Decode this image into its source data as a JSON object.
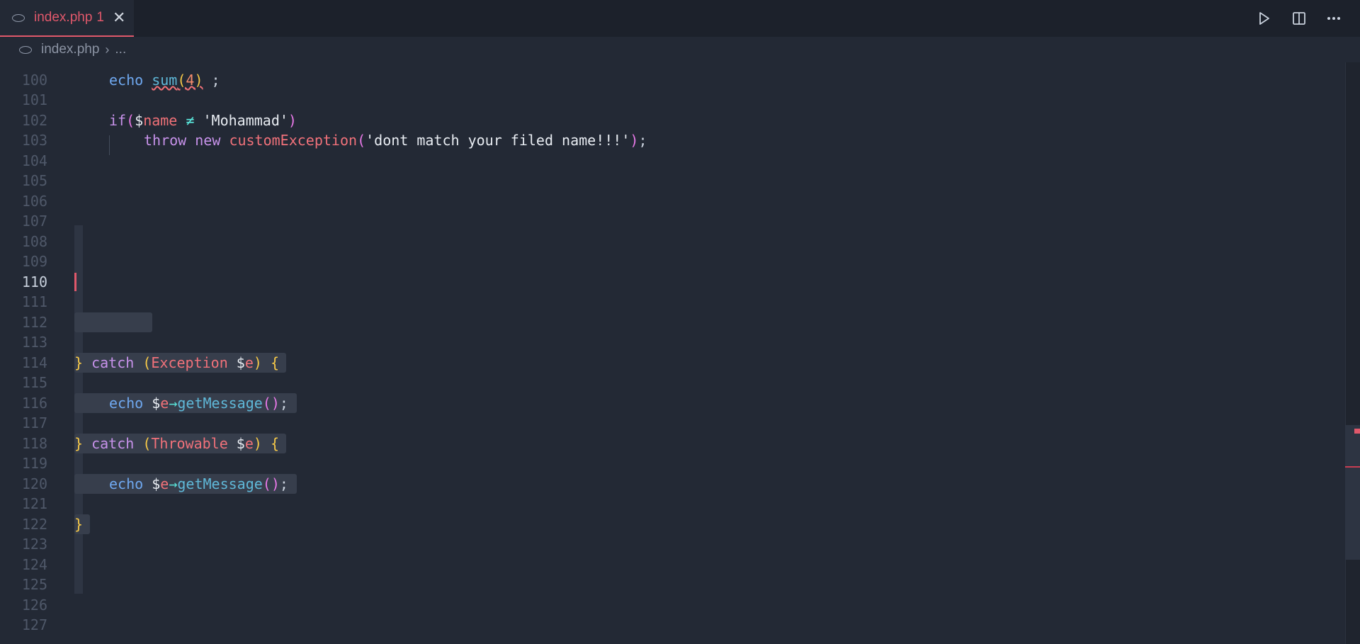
{
  "tab": {
    "file_icon": "php-icon",
    "label": "index.php",
    "problem_count": "1",
    "close_icon": "close-icon"
  },
  "toolbar": {
    "run_icon": "play-icon",
    "split_icon": "split-editor-icon",
    "more_icon": "more-actions-icon"
  },
  "breadcrumb": {
    "file": "index.php",
    "more": "..."
  },
  "editor": {
    "active_line": "110",
    "line_numbers": [
      "100",
      "101",
      "102",
      "103",
      "104",
      "105",
      "106",
      "107",
      "108",
      "109",
      "110",
      "111",
      "112",
      "113",
      "114",
      "115",
      "116",
      "117",
      "118",
      "119",
      "120",
      "121",
      "122",
      "123",
      "124",
      "125",
      "126",
      "127"
    ],
    "code": {
      "l100": {
        "a": "echo",
        "b": "sum",
        "c": "(",
        "d": "4",
        "e": ")",
        "f": " ;"
      },
      "l102": {
        "a": "if",
        "b": "(",
        "c": "$",
        "d": "name",
        "e": " ≠ ",
        "f": "'Mohammad'",
        "g": ")"
      },
      "l103": {
        "a": "throw",
        "b": " new ",
        "c": "customException",
        "d": "(",
        "e": "'dont match your filed name!!!'",
        "f": ")",
        "g": ";"
      },
      "l114": {
        "a": "}",
        "b": " catch ",
        "c": "(",
        "d": "Exception",
        "e": " $",
        "f": "e",
        "g": ")",
        "h": " {"
      },
      "l116": {
        "a": "echo",
        "b": " $",
        "c": "e",
        "d": "→",
        "e": "getMessage",
        "f": "()",
        "g": ";"
      },
      "l118": {
        "a": "}",
        "b": " catch ",
        "c": "(",
        "d": "Throwable",
        "e": " $",
        "f": "e",
        "g": ")",
        "h": " {"
      },
      "l120": {
        "a": "echo",
        "b": " $",
        "c": "e",
        "d": "→",
        "e": "getMessage",
        "f": "()",
        "g": ";"
      },
      "l122": {
        "a": "}"
      }
    }
  },
  "colors": {
    "background": "#232935",
    "tab_active": "#e0586b",
    "keyword": "#c792ea",
    "function": "#5fb8d8",
    "class": "#f0717a"
  }
}
